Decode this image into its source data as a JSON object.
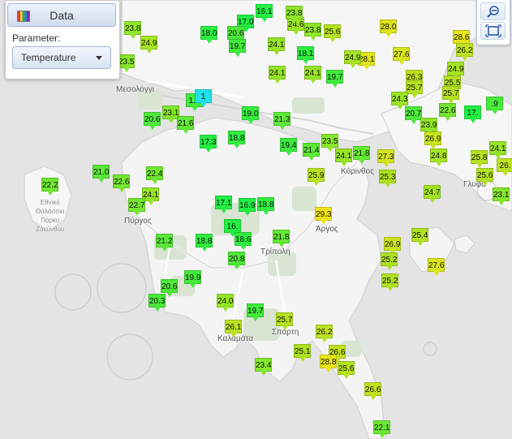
{
  "panel": {
    "button_label": "Data",
    "button_icon": "palette-icon",
    "parameter_label": "Parameter:",
    "parameter_value": "Temperature"
  },
  "controls": {
    "zoom_out_icon": "zoom-out-icon",
    "zoom_extent_icon": "zoom-extent-icon"
  },
  "places": [
    {
      "id": "mesolongi",
      "text": "Μεσολόγγι",
      "size": "normal"
    },
    {
      "id": "korinthos",
      "text": "Κόρινθος",
      "size": "normal"
    },
    {
      "id": "glyfada",
      "text": "Γλυφά",
      "size": "normal"
    },
    {
      "id": "pyrgos",
      "text": "Πύργος",
      "size": "normal"
    },
    {
      "id": "argos",
      "text": "Άργος",
      "size": "normal"
    },
    {
      "id": "tripoli",
      "text": "Τρίπολη",
      "size": "normal"
    },
    {
      "id": "kalamata",
      "text": "Καλαμάτα",
      "size": "normal"
    },
    {
      "id": "sparti",
      "text": "Σπάρτη",
      "size": "normal"
    },
    {
      "id": "zakynthos",
      "text": "Εθνικό\nΘαλάσσιο\nΠάρκο\nΖακύνθου",
      "size": "small"
    }
  ],
  "stations": [
    {
      "v": "16.1",
      "c": "#22ee44"
    },
    {
      "v": "17.0",
      "c": "#20ec48"
    },
    {
      "v": "23.8",
      "c": "#8ee62a"
    },
    {
      "v": "24.6",
      "c": "#9ee426"
    },
    {
      "v": "23.8",
      "c": "#8ee62a"
    },
    {
      "v": "25.6",
      "c": "#b4e222"
    },
    {
      "v": "28.0",
      "c": "#e0e41c"
    },
    {
      "v": "20.6",
      "c": "#4ee83a"
    },
    {
      "v": "18.0",
      "c": "#2cee40"
    },
    {
      "v": "24.1",
      "c": "#96e428"
    },
    {
      "v": "18.1",
      "c": "#2cee40"
    },
    {
      "v": "19.7",
      "c": "#40ea3c"
    },
    {
      "v": "24.9",
      "c": "#a6e424"
    },
    {
      "v": "28.1",
      "c": "#e2e41c"
    },
    {
      "v": "23.8",
      "c": "#8ee62a"
    },
    {
      "v": "24.9",
      "c": "#a6e424"
    },
    {
      "v": "23.5",
      "c": "#88e62c"
    },
    {
      "v": "27.6",
      "c": "#d8e41e"
    },
    {
      "v": "28.6",
      "c": "#e6e41a"
    },
    {
      "v": "26.2",
      "c": "#bce222"
    },
    {
      "v": "24.9",
      "c": "#a6e424"
    },
    {
      "v": "24.1",
      "c": "#96e428"
    },
    {
      "v": "24.1",
      "c": "#96e428"
    },
    {
      "v": "19.7",
      "c": "#40ea3c"
    },
    {
      "v": "26.3",
      "c": "#bee220"
    },
    {
      "v": "25.5",
      "c": "#b2e222"
    },
    {
      "v": "25.7",
      "c": "#b4e222"
    },
    {
      "v": "25.7",
      "c": "#b4e222"
    },
    {
      "v": "24.3",
      "c": "#9ae426"
    },
    {
      "v": "20.7",
      "c": "#4ee83a"
    },
    {
      "v": "22.6",
      "c": "#74e630"
    },
    {
      "v": "17.",
      "c": "#24ee44"
    },
    {
      "v": ".9",
      "c": "#48ea3a"
    },
    {
      "v": "20.6",
      "c": "#4ee83a"
    },
    {
      "v": "23.1",
      "c": "#84e62c"
    },
    {
      "v": "21.6",
      "c": "#60e836"
    },
    {
      "v": "1.2",
      "c": "#40ea3c"
    },
    {
      "v": "19.0",
      "c": "#34ec3e"
    },
    {
      "v": "21.3",
      "c": "#5ce836"
    },
    {
      "v": "23.9",
      "c": "#90e62a"
    },
    {
      "v": "26.9",
      "c": "#c8e41e"
    },
    {
      "v": "17.3",
      "c": "#24ee44"
    },
    {
      "v": "18.8",
      "c": "#30ec40"
    },
    {
      "v": "19.4",
      "c": "#3aea3e"
    },
    {
      "v": "21.4",
      "c": "#5ce836"
    },
    {
      "v": "23.5",
      "c": "#88e62c"
    },
    {
      "v": "24.1",
      "c": "#96e428"
    },
    {
      "v": "21.8",
      "c": "#64e834"
    },
    {
      "v": "27.3",
      "c": "#d2e41e"
    },
    {
      "v": "24.8",
      "c": "#a4e424"
    },
    {
      "v": "25.8",
      "c": "#b6e222"
    },
    {
      "v": "24.1",
      "c": "#96e428"
    },
    {
      "v": "21.0",
      "c": "#58e838"
    },
    {
      "v": "22.2",
      "c": "#6ee632"
    },
    {
      "v": "22.6",
      "c": "#74e630"
    },
    {
      "v": "22.4",
      "c": "#70e630"
    },
    {
      "v": "25.9",
      "c": "#b8e222"
    },
    {
      "v": "25.3",
      "c": "#aee222"
    },
    {
      "v": "25.6",
      "c": "#b4e222"
    },
    {
      "v": "26.",
      "c": "#bce222"
    },
    {
      "v": "24.7",
      "c": "#a2e424"
    },
    {
      "v": "23.1",
      "c": "#84e62c"
    },
    {
      "v": "24.1",
      "c": "#96e428"
    },
    {
      "v": "22.7",
      "c": "#76e630"
    },
    {
      "v": "17.1",
      "c": "#24ee44"
    },
    {
      "v": "16.9",
      "c": "#22ee44"
    },
    {
      "v": "18.8",
      "c": "#30ec40"
    },
    {
      "v": "16.",
      "c": "#22ee44"
    },
    {
      "v": "29.3",
      "c": "#f0e418"
    },
    {
      "v": "25.4",
      "c": "#b0e222"
    },
    {
      "v": "21.2",
      "c": "#5ae838"
    },
    {
      "v": "18.8",
      "c": "#30ec40"
    },
    {
      "v": "18.6",
      "c": "#30ec40"
    },
    {
      "v": "21.8",
      "c": "#64e834"
    },
    {
      "v": "26.9",
      "c": "#c8e41e"
    },
    {
      "v": "20.8",
      "c": "#50e83a"
    },
    {
      "v": "25.2",
      "c": "#aee222"
    },
    {
      "v": "27.6",
      "c": "#d8e41e"
    },
    {
      "v": "19.9",
      "c": "#44ea3c"
    },
    {
      "v": "20.6",
      "c": "#4ee83a"
    },
    {
      "v": "25.2",
      "c": "#aee222"
    },
    {
      "v": "20.3",
      "c": "#4ae83a"
    },
    {
      "v": "24.0",
      "c": "#94e428"
    },
    {
      "v": "19.7",
      "c": "#40ea3c"
    },
    {
      "v": "25.7",
      "c": "#b4e222"
    },
    {
      "v": "26.1",
      "c": "#bae222"
    },
    {
      "v": "26.2",
      "c": "#bce222"
    },
    {
      "v": "25.1",
      "c": "#aee222"
    },
    {
      "v": "26.6",
      "c": "#c2e220"
    },
    {
      "v": "28.8",
      "c": "#e8e41a"
    },
    {
      "v": "25.6",
      "c": "#b4e222"
    },
    {
      "v": "23.4",
      "c": "#86e62c"
    },
    {
      "v": "26.6",
      "c": "#c2e220"
    },
    {
      "v": "22.1",
      "c": "#6ce632"
    },
    {
      "v": "1",
      "c": "#20e0e8"
    }
  ]
}
